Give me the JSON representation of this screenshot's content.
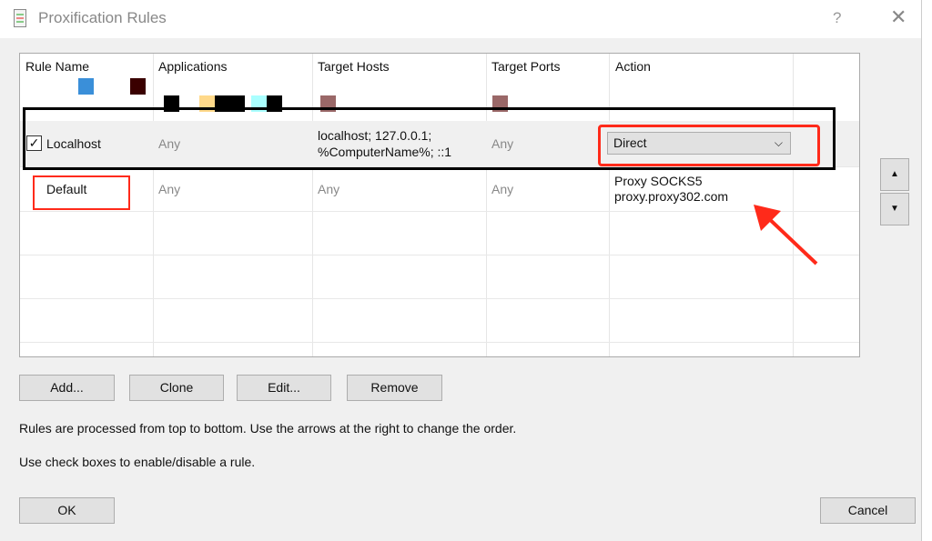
{
  "window": {
    "title": "Proxification Rules",
    "help": "?",
    "close": "✕"
  },
  "table": {
    "columns": [
      "Rule Name",
      "Applications",
      "Target Hosts",
      "Target Ports",
      "Action"
    ],
    "rows": [
      {
        "enabled": true,
        "name": "Localhost",
        "applications": "Any",
        "hosts_line1": "localhost; 127.0.0.1;",
        "hosts_line2": "%ComputerName%; ::1",
        "ports": "Any",
        "action": "Direct"
      },
      {
        "name": "Default",
        "applications": "Any",
        "hosts": "Any",
        "ports": "Any",
        "action_line1": "Proxy SOCKS5",
        "action_line2": "proxy.proxy302.com"
      }
    ]
  },
  "buttons": {
    "add": "Add...",
    "clone": "Clone",
    "edit": "Edit...",
    "remove": "Remove",
    "ok": "OK",
    "cancel": "Cancel",
    "up": "▲",
    "down": "▼"
  },
  "info": {
    "line1": "Rules are processed from top to bottom. Use the arrows at the right to change the order.",
    "line2": "Use check boxes to enable/disable a rule."
  },
  "annotation_color": "#ff2a1a"
}
